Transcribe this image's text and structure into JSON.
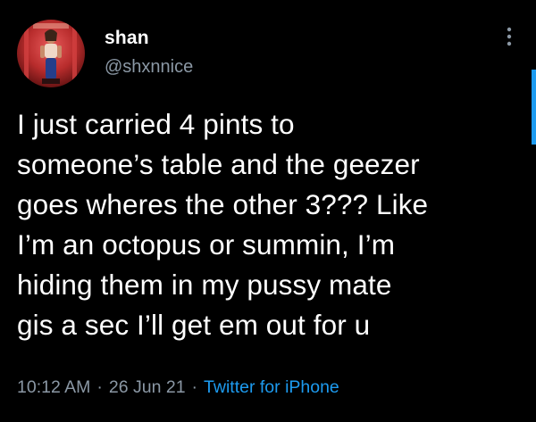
{
  "user": {
    "display_name": "shan",
    "handle": "@shxnnice",
    "avatar_icon": "profile-photo-avatar"
  },
  "tweet": {
    "text": "I just carried 4 pints to\nsomeone’s table and the geezer\ngoes wheres the other 3??? Like\nI’m an octopus or summin, I’m\nhiding them in my pussy mate\ngis a sec I’ll get em out for u"
  },
  "meta": {
    "time": "10:12 AM",
    "separator": "·",
    "date": "26 Jun 21",
    "source": "Twitter for iPhone"
  },
  "icons": {
    "more": "more-options-icon"
  },
  "colors": {
    "background": "#000000",
    "primary_text": "#ffffff",
    "secondary_text": "#8b98a5",
    "accent": "#1d9bf0"
  }
}
